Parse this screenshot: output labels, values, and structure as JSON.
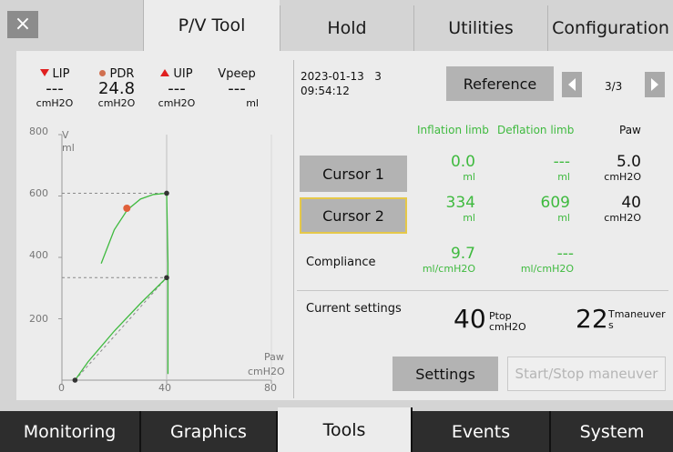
{
  "top_tabs": {
    "close_symbol": "×",
    "tabs": [
      {
        "label": "P/V Tool",
        "active": true
      },
      {
        "label": "Hold",
        "active": false
      },
      {
        "label": "Utilities",
        "active": false
      },
      {
        "label": "Configuration",
        "active": false
      }
    ]
  },
  "measurements": [
    {
      "label": "LIP",
      "marker": "red-down-triangle-icon",
      "value": "---",
      "unit": "cmH2O"
    },
    {
      "label": "PDR",
      "marker": "orange-dot-icon",
      "value": "24.8",
      "unit": "cmH2O"
    },
    {
      "label": "UIP",
      "marker": "red-up-triangle-icon",
      "value": "---",
      "unit": "cmH2O"
    },
    {
      "label": "Vpeep",
      "marker": "",
      "value": "---",
      "unit": "ml"
    }
  ],
  "graph": {
    "y_axis_label": "V",
    "y_axis_unit": "ml",
    "x_axis_label": "Paw",
    "x_axis_unit": "cmH2O",
    "y_ticks": [
      "800",
      "600",
      "400",
      "200"
    ],
    "x_ticks": [
      "0",
      "40",
      "80"
    ]
  },
  "chart_data": {
    "type": "line",
    "xlim": [
      0,
      80
    ],
    "ylim": [
      0,
      800
    ],
    "xlabel": "Paw",
    "ylabel": "V",
    "series": [
      {
        "name": "",
        "x": [
          5,
          10,
          20,
          30,
          40
        ],
        "y": [
          0,
          60,
          160,
          250,
          334
        ]
      },
      {
        "name": "",
        "x": [
          15,
          20,
          25,
          30,
          35,
          40
        ],
        "y": [
          380,
          490,
          555,
          590,
          605,
          609
        ]
      },
      {
        "name": "",
        "x": [
          40,
          40.5,
          40.5
        ],
        "y": [
          609,
          380,
          20
        ]
      }
    ],
    "markers": [
      {
        "x": 24.8,
        "y": 560,
        "color": "#e0603a"
      },
      {
        "x": 40,
        "y": 609,
        "color": "#333333"
      },
      {
        "x": 40,
        "y": 334,
        "color": "#333333"
      },
      {
        "x": 5,
        "y": 0,
        "color": "#333333"
      }
    ],
    "dashed_lines": [
      {
        "x": [
          0,
          40
        ],
        "y": [
          609,
          609
        ]
      },
      {
        "x": [
          0,
          40
        ],
        "y": [
          334,
          334
        ]
      },
      {
        "x": [
          5,
          40
        ],
        "y": [
          0,
          334
        ]
      }
    ]
  },
  "timestamp": {
    "date": "2023-01-13",
    "index": "3",
    "time": "09:54:12"
  },
  "reference_button": "Reference",
  "pager": "3/3",
  "columns": {
    "inflation": "Inflation limb",
    "deflation": "Deflation limb",
    "paw": "Paw"
  },
  "cursor1": {
    "label": "Cursor 1",
    "inflation": {
      "value": "0.0",
      "unit": "ml"
    },
    "deflation": {
      "value": "---",
      "unit": "ml"
    },
    "paw": {
      "value": "5.0",
      "unit": "cmH2O"
    }
  },
  "cursor2": {
    "label": "Cursor 2",
    "inflation": {
      "value": "334",
      "unit": "ml"
    },
    "deflation": {
      "value": "609",
      "unit": "ml"
    },
    "paw": {
      "value": "40",
      "unit": "cmH2O"
    }
  },
  "compliance": {
    "label": "Compliance",
    "inflation": {
      "value": "9.7",
      "unit": "ml/cmH2O"
    },
    "deflation": {
      "value": "---",
      "unit": "ml/cmH2O"
    }
  },
  "current_settings": {
    "label": "Current settings",
    "ptop_value": "40",
    "ptop_label": "Ptop",
    "ptop_unit": "cmH2O",
    "tman_value": "22",
    "tman_label": "Tmaneuver",
    "tman_unit": "s"
  },
  "settings_button": "Settings",
  "startstop_button": "Start/Stop maneuver",
  "bottom_tabs": [
    {
      "label": "Monitoring",
      "active": false
    },
    {
      "label": "Graphics",
      "active": false
    },
    {
      "label": "Tools",
      "active": true
    },
    {
      "label": "Events",
      "active": false
    },
    {
      "label": "System",
      "active": false
    }
  ],
  "colors": {
    "green": "#3fba3f",
    "red": "#e02020",
    "highlight": "#e5c84a"
  }
}
